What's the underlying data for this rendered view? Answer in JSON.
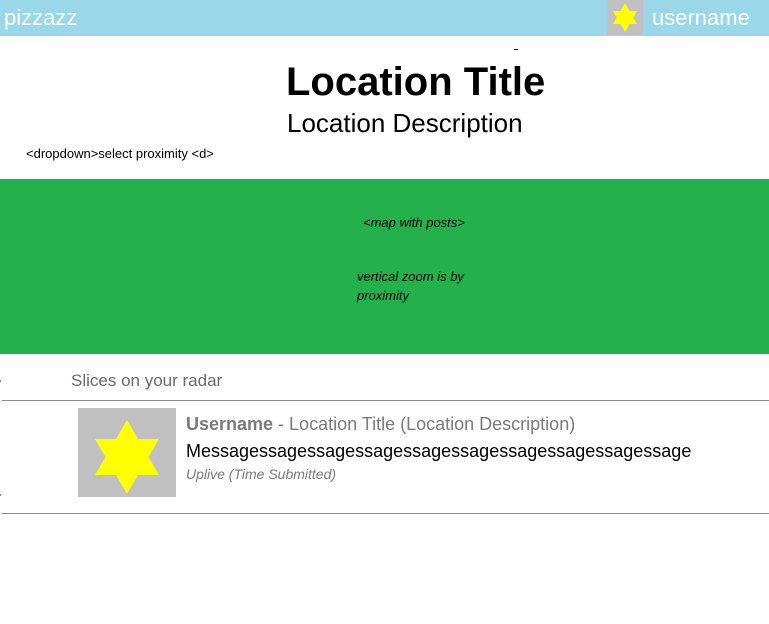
{
  "header": {
    "brand": "pizzazz",
    "username": "username",
    "background_color": "#9ad7e9",
    "avatar_icon": "star-of-david-icon"
  },
  "location": {
    "title": "Location Title",
    "description": "Location Description"
  },
  "proximity_dropdown": {
    "label": "<dropdown>select proximity <d>"
  },
  "map": {
    "background_color": "#24b14c",
    "label": "<map with posts>",
    "note": "vertical zoom is by proximity"
  },
  "feed": {
    "heading": "Slices on your radar",
    "posts": [
      {
        "username": "Username",
        "separator": " - ",
        "location": "Location Title (Location Description)",
        "message": "Messagessagessagessagessagessagessagessagessagessage",
        "meta": "Uplive (Time Submitted)",
        "avatar_icon": "star-of-david-icon"
      }
    ]
  },
  "colors": {
    "star": "#ffff00",
    "avatar_bg": "#c0c0c0"
  }
}
